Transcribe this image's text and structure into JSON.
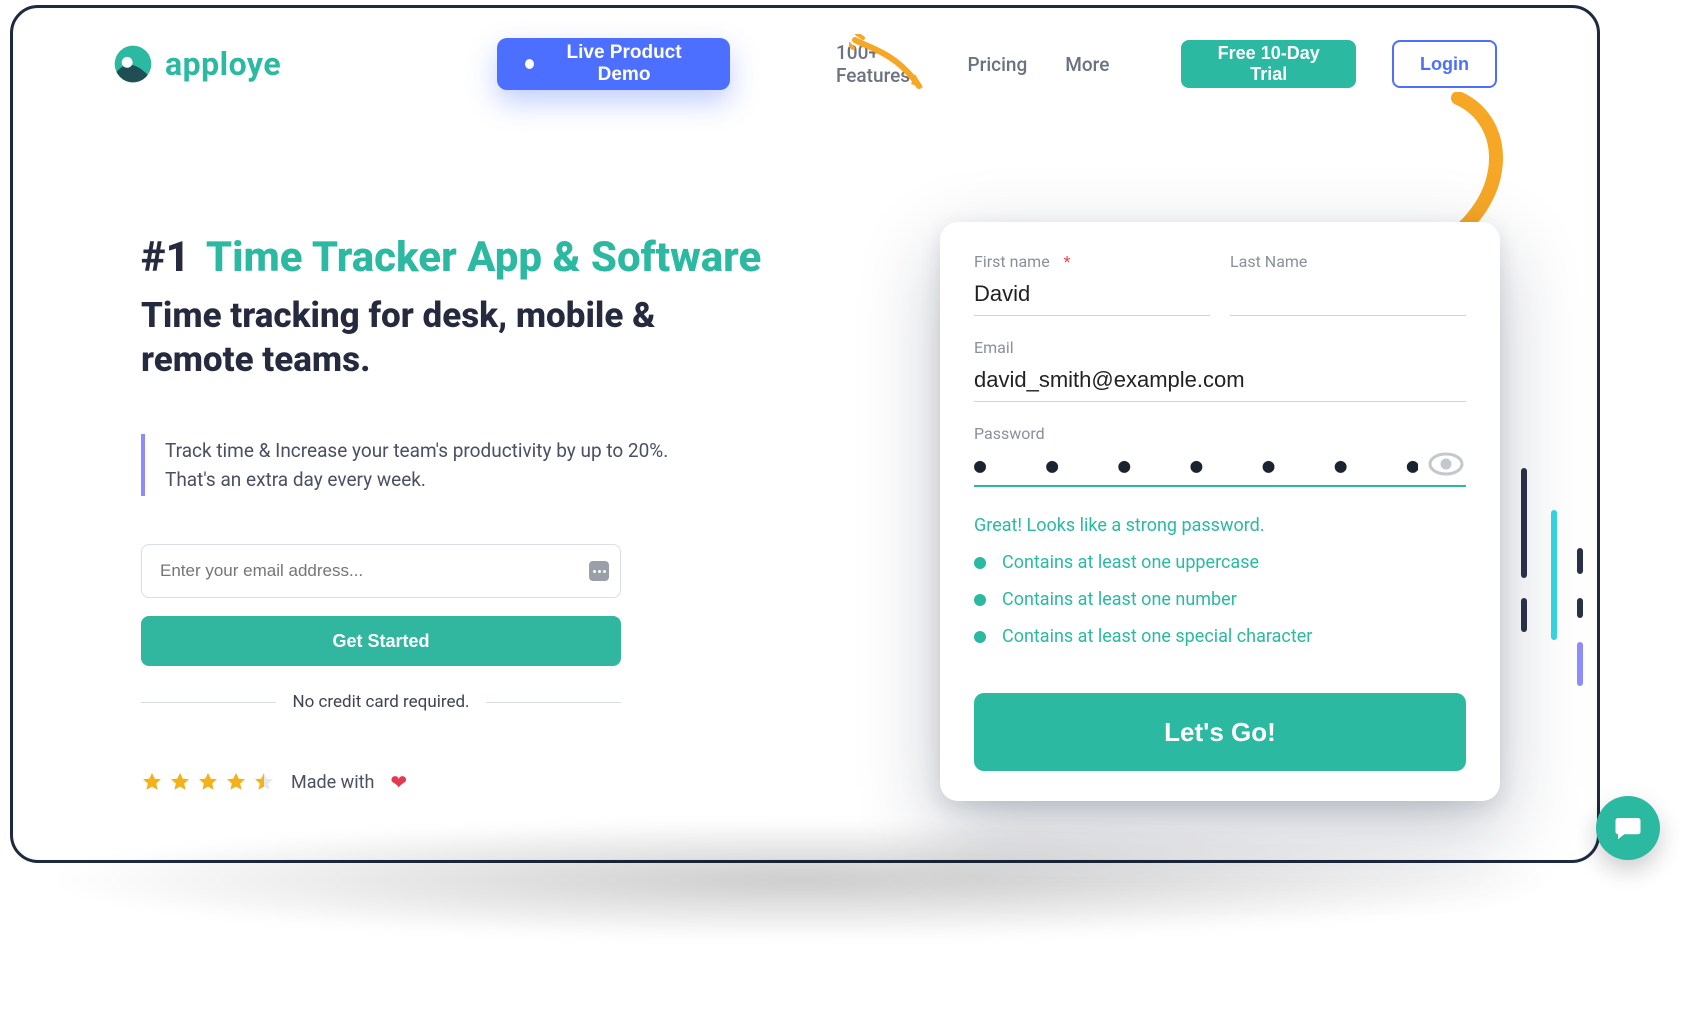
{
  "brand": {
    "name": "apploye"
  },
  "nav": {
    "demo": "Live Product Demo",
    "features": "100+ Features",
    "pricing": "Pricing",
    "more": "More",
    "trial": "Free 10-Day Trial",
    "login": "Login"
  },
  "hero": {
    "rank": "#1",
    "title": "Time Tracker App & Software",
    "subtitle": "Time tracking for desk, mobile & remote teams.",
    "quote": "Track time & Increase your team's productivity by up to 20%. That's an extra day every week.",
    "email_placeholder": "Enter your email address...",
    "get_started": "Get Started",
    "no_card": "No credit card required.",
    "made_with": "Made with"
  },
  "signup": {
    "first_name_label": "First name",
    "last_name_label": "Last Name",
    "email_label": "Email",
    "password_label": "Password",
    "first_name_value": "David",
    "last_name_value": "",
    "email_value": "david_smith@example.com",
    "password_mask": "●  ●  ●  ●  ●  ●  ●",
    "strength_msg": "Great! Looks like a strong password.",
    "checks": {
      "c1": "Contains at least one uppercase",
      "c2": "Contains at least one number",
      "c3": "Contains at least one special character"
    },
    "submit": "Let's Go!"
  },
  "colors": {
    "teal": "#2bb9a1",
    "indigo": "#4c6fff",
    "orange": "#f6a726"
  }
}
